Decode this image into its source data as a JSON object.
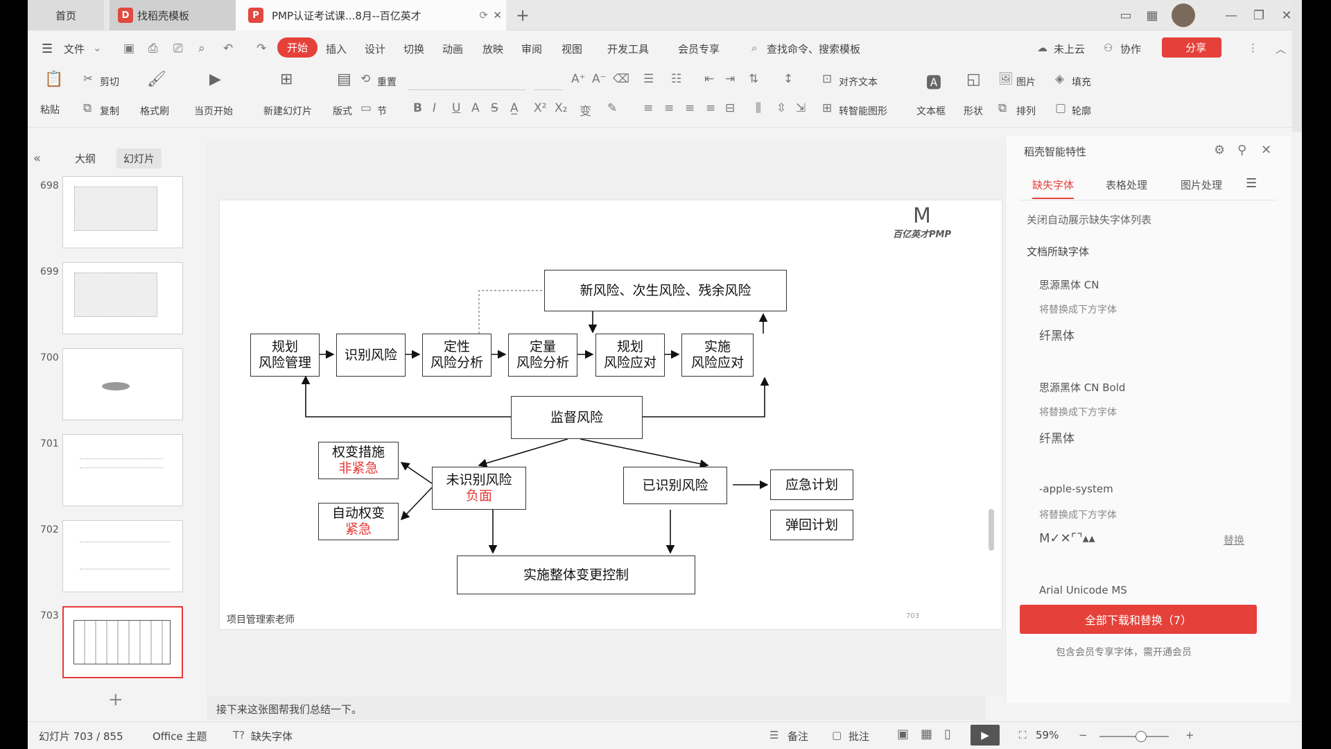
{
  "titlebar": {
    "home_tab": "首页",
    "template_tab": "找稻壳模板",
    "doc_tab": "PMP认证考试课...8月--百亿英才",
    "doc_icon": "P",
    "new_tab_icon": "+",
    "close_icon": "✕"
  },
  "menu": {
    "file": "文件",
    "items": [
      "开始",
      "插入",
      "设计",
      "切换",
      "动画",
      "放映",
      "审阅",
      "视图",
      "开发工具",
      "会员专享"
    ],
    "search": "查找命令、搜索模板",
    "cloud": "未上云",
    "collab": "协作",
    "share": "分享"
  },
  "ribbon": {
    "paste": "粘贴",
    "cut": "剪切",
    "copy": "复制",
    "format_painter": "格式刷",
    "start_here": "当页开始",
    "new_slide": "新建幻灯片",
    "layout": "版式",
    "section": "节",
    "reset": "重置",
    "align_text": "对齐文本",
    "smartart": "转智能图形",
    "textbox": "文本框",
    "shape": "形状",
    "picture": "图片",
    "arrange": "排列",
    "fill": "填充",
    "outline": "轮廓"
  },
  "leftpanel": {
    "outline_tab": "大纲",
    "slides_tab": "幻灯片",
    "thumbnails": [
      "698",
      "699",
      "700",
      "701",
      "702",
      "703"
    ],
    "add": "+"
  },
  "slide": {
    "logo": "百亿英才PMP",
    "footer_left": "项目管理索老师",
    "page_num": "703",
    "boxes": {
      "new_risk": "新风险、次生风险、残余风险",
      "plan_rm_1": "规划",
      "plan_rm_2": "风险管理",
      "identify": "识别风险",
      "qual_1": "定性",
      "qual_2": "风险分析",
      "quant_1": "定量",
      "quant_2": "风险分析",
      "plan_resp_1": "规划",
      "plan_resp_2": "风险应对",
      "impl_1": "实施",
      "impl_2": "风险应对",
      "monitor": "监督风险",
      "workaround_1": "权变措施",
      "workaround_2": "非紧急",
      "auto_1": "自动权变",
      "auto_2": "紧急",
      "unidentified_1": "未识别风险",
      "unidentified_2": "负面",
      "identified": "已识别风险",
      "contingency": "应急计划",
      "fallback": "弹回计划",
      "change_control": "实施整体变更控制"
    }
  },
  "notes": "接下来这张图帮我们总结一下。",
  "rightpanel": {
    "title": "稻壳智能特性",
    "tabs": [
      "缺失字体",
      "表格处理",
      "图片处理"
    ],
    "close_auto": "关闭自动展示缺失字体列表",
    "missing_header": "文档所缺字体",
    "fonts": [
      {
        "name": "思源黑体 CN",
        "replace_label": "将替换成下方字体",
        "replacement": "纤黑体"
      },
      {
        "name": "思源黑体 CN Bold",
        "replace_label": "将替换成下方字体",
        "replacement": "纤黑体"
      },
      {
        "name": "-apple-system",
        "replace_label": "将替换成下方字体",
        "replacement": "M✓✕⌜⌝▴▴",
        "action": "替换"
      }
    ],
    "cut_font": "Arial Unicode MS",
    "download_all": "全部下载和替换（7）",
    "member_note": "包含会员专享字体，需开通会员"
  },
  "status": {
    "slide_count": "幻灯片 703 / 855",
    "theme": "Office 主题",
    "missing_font": "缺失字体",
    "notes": "备注",
    "comments": "批注",
    "zoom": "59%"
  },
  "colors": {
    "accent": "#e5413a",
    "selected_thumb": "#e53935"
  }
}
